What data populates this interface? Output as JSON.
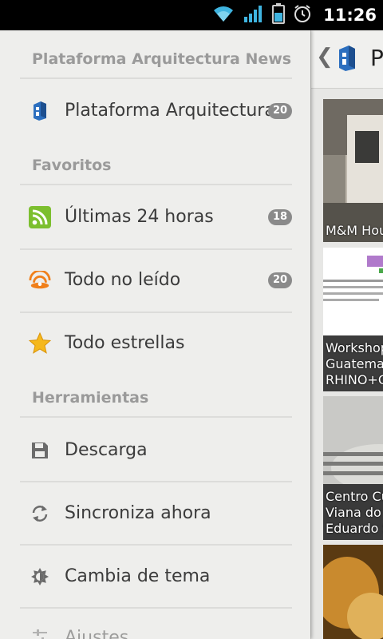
{
  "status": {
    "time": "11:26"
  },
  "drawer": {
    "app_title": "Plataforma Arquitectura News",
    "feed": {
      "label": "Plataforma Arquitectura",
      "count": "20"
    },
    "favorites_header": "Favoritos",
    "favorites": [
      {
        "label": "Últimas 24 horas",
        "count": "18",
        "icon": "rss-icon"
      },
      {
        "label": "Todo no leído",
        "count": "20",
        "icon": "unread-icon"
      },
      {
        "label": "Todo estrellas",
        "count": "",
        "icon": "star-icon"
      }
    ],
    "tools_header": "Herramientas",
    "tools": [
      {
        "label": "Descarga",
        "icon": "save-icon"
      },
      {
        "label": "Sincroniza ahora",
        "icon": "sync-icon"
      },
      {
        "label": "Cambia de tema",
        "icon": "theme-icon"
      },
      {
        "label": "Ajustes",
        "icon": "settings-icon"
      }
    ]
  },
  "content": {
    "title": "P",
    "cards": [
      {
        "caption": "M&M Hou"
      },
      {
        "caption_lines": [
          "Workshop",
          "Guatemal",
          "RHINO+G"
        ]
      },
      {
        "caption_lines": [
          "Centro Cu",
          "Viana do C",
          "Eduardo S"
        ]
      }
    ]
  },
  "colors": {
    "drawer_bg": "#eeeeec",
    "badge": "#8a8a8a",
    "status_bar": "#000000"
  }
}
